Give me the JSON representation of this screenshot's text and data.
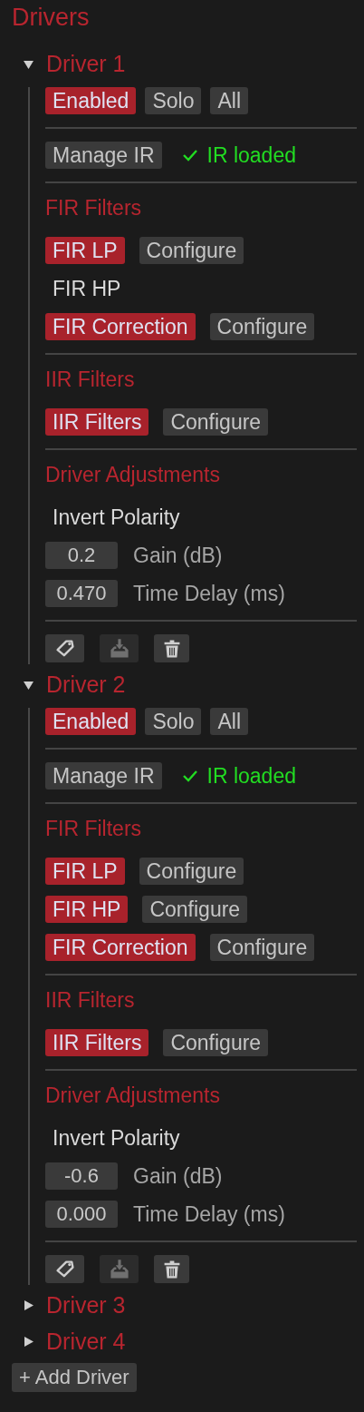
{
  "title": "Drivers",
  "drivers": [
    {
      "name": "Driver 1",
      "expanded": true,
      "modes": [
        {
          "label": "Enabled",
          "selected": true
        },
        {
          "label": "Solo",
          "selected": false
        },
        {
          "label": "All",
          "selected": false
        }
      ],
      "ir": {
        "button": "Manage IR",
        "status": "IR loaded",
        "loaded": true
      },
      "fir": {
        "heading": "FIR Filters",
        "filters": [
          {
            "label": "FIR LP",
            "selected": true,
            "configure": "Configure"
          },
          {
            "label": "FIR HP",
            "selected": false
          },
          {
            "label": "FIR Correction",
            "selected": true,
            "configure": "Configure"
          }
        ]
      },
      "iir": {
        "heading": "IIR Filters",
        "filters": [
          {
            "label": "IIR Filters",
            "selected": true,
            "configure": "Configure"
          }
        ]
      },
      "adjustments": {
        "heading": "Driver Adjustments",
        "invert": {
          "label": "Invert Polarity",
          "selected": false
        },
        "fields": [
          {
            "value": "0.2",
            "label": "Gain (dB)"
          },
          {
            "value": "0.470",
            "label": "Time Delay (ms)"
          }
        ]
      },
      "actions": [
        {
          "kind": "tag",
          "disabled": false
        },
        {
          "kind": "import",
          "disabled": true
        },
        {
          "kind": "delete",
          "disabled": false
        }
      ]
    },
    {
      "name": "Driver 2",
      "expanded": true,
      "modes": [
        {
          "label": "Enabled",
          "selected": true
        },
        {
          "label": "Solo",
          "selected": false
        },
        {
          "label": "All",
          "selected": false
        }
      ],
      "ir": {
        "button": "Manage IR",
        "status": "IR loaded",
        "loaded": true
      },
      "fir": {
        "heading": "FIR Filters",
        "filters": [
          {
            "label": "FIR LP",
            "selected": true,
            "configure": "Configure"
          },
          {
            "label": "FIR HP",
            "selected": true,
            "configure": "Configure"
          },
          {
            "label": "FIR Correction",
            "selected": true,
            "configure": "Configure"
          }
        ]
      },
      "iir": {
        "heading": "IIR Filters",
        "filters": [
          {
            "label": "IIR Filters",
            "selected": true,
            "configure": "Configure"
          }
        ]
      },
      "adjustments": {
        "heading": "Driver Adjustments",
        "invert": {
          "label": "Invert Polarity",
          "selected": false
        },
        "fields": [
          {
            "value": "-0.6",
            "label": "Gain (dB)"
          },
          {
            "value": "0.000",
            "label": "Time Delay (ms)"
          }
        ]
      },
      "actions": [
        {
          "kind": "tag",
          "disabled": false
        },
        {
          "kind": "import",
          "disabled": true
        },
        {
          "kind": "delete",
          "disabled": false
        }
      ]
    },
    {
      "name": "Driver 3",
      "expanded": false
    },
    {
      "name": "Driver 4",
      "expanded": false
    }
  ],
  "add_button": "+ Add Driver"
}
